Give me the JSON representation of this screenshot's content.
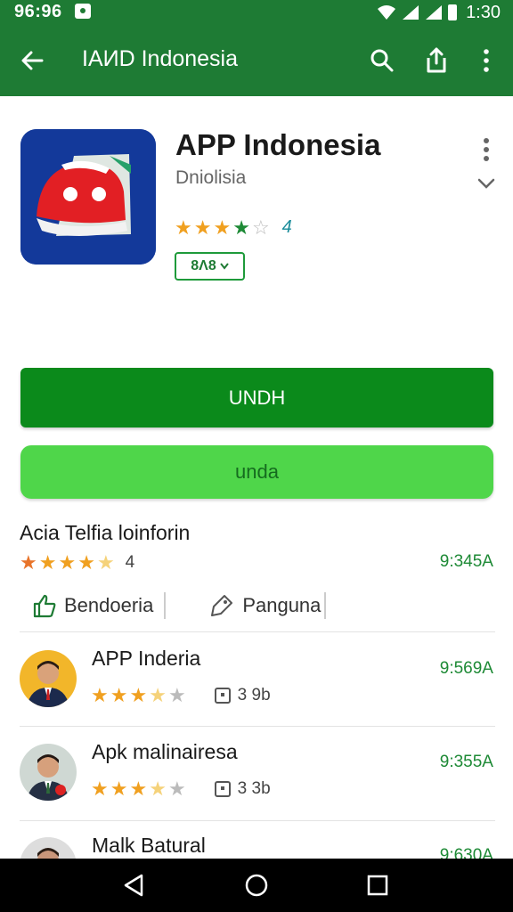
{
  "status": {
    "time": "96:96",
    "clock": "1:30"
  },
  "appbar": {
    "title": "IAИD Indonesia"
  },
  "app": {
    "name": "APP Indonesia",
    "developer": "Dniolisia",
    "rating": "4",
    "stars": 3.5,
    "version": "8Λ8"
  },
  "buttons": {
    "primary": "UNDH",
    "secondary": "unda"
  },
  "section": {
    "title": "Acia Telfia loinforin",
    "rating": "4",
    "time": "9:345A",
    "actions": [
      {
        "label": "Bendoeria"
      },
      {
        "label": "Panguna"
      }
    ]
  },
  "list": [
    {
      "title": "APP Inderia",
      "size": "3 9b",
      "time": "9:569A"
    },
    {
      "title": "Apk malinairesa",
      "size": "3 3b",
      "time": "9:355A"
    },
    {
      "title": "Malk Batural",
      "time": "9:630A"
    }
  ],
  "colors": {
    "topbar": "#1e7b34",
    "primary": "#0b8a1b",
    "secondary": "#4fd64a",
    "star": "#f0a020"
  }
}
